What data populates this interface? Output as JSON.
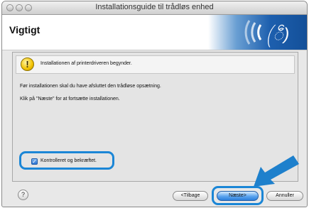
{
  "window": {
    "title": "Installationsguide til trådløs enhed"
  },
  "header": {
    "heading": "Vigtigt"
  },
  "info": {
    "message": "Installationen af printerdriveren begynder."
  },
  "body": {
    "line1": "Før installationen skal du have afsluttet den trådløse opsætning.",
    "line2": "Klik på \"Næste\" for at fortsætte installationen."
  },
  "checkbox": {
    "label": "Kontrolleret og bekræftet.",
    "checked": true
  },
  "buttons": {
    "back": "<Tilbage",
    "next": "Næste>",
    "cancel": "Annuller",
    "help": "?"
  },
  "icons": {
    "warning": "warning-icon",
    "wireless_logo": "wireless-logo-icon",
    "arrow": "pointer-arrow-icon"
  },
  "colors": {
    "highlight": "#1b86d6",
    "logo_blue": "#1d5fae"
  }
}
